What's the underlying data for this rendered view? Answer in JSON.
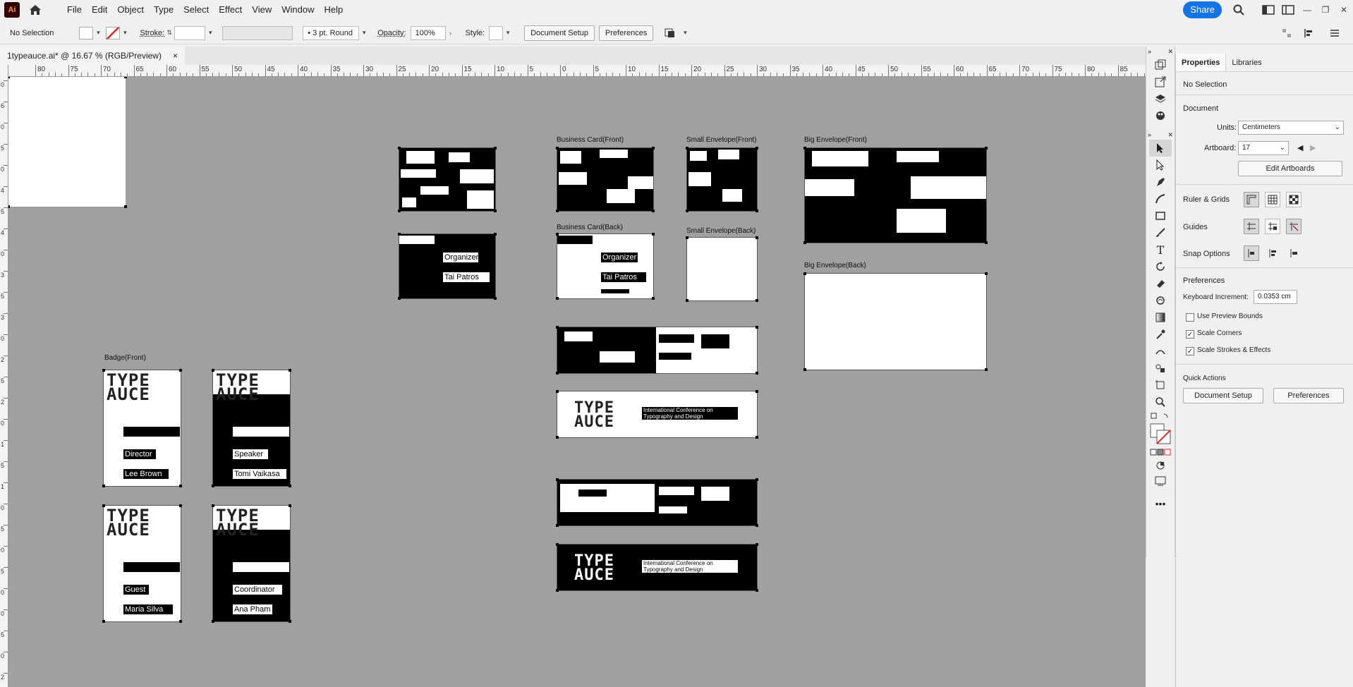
{
  "app": {
    "logo": "Ai"
  },
  "menu": [
    "File",
    "Edit",
    "Object",
    "Type",
    "Select",
    "Effect",
    "View",
    "Window",
    "Help"
  ],
  "topbar": {
    "share": "Share"
  },
  "control": {
    "selection": "No Selection",
    "stroke_label": "Stroke:",
    "brush": "3 pt. Round",
    "opacity_label": "Opacity:",
    "opacity": "100%",
    "style_label": "Style:",
    "doc_setup": "Document Setup",
    "preferences": "Preferences"
  },
  "doc_tab": {
    "title": "1typeauce.ai* @ 16.67 % (RGB/Preview)",
    "close": "×"
  },
  "ruler": {
    "labels": [
      "80",
      "75",
      "70",
      "65",
      "60",
      "55",
      "50",
      "45",
      "40",
      "35",
      "30",
      "25",
      "20",
      "15",
      "10",
      "5",
      "0",
      "5",
      "10",
      "15",
      "20",
      "25",
      "30",
      "35",
      "40",
      "45",
      "50",
      "55",
      "60",
      "65",
      "70",
      "75",
      "80",
      "85"
    ]
  },
  "ruler_v": {
    "labels": [
      "0",
      "6",
      "0",
      "5",
      "0",
      "4",
      "5",
      "4",
      "0",
      "3",
      "5",
      "3",
      "0",
      "2",
      "5",
      "2",
      "0",
      "1",
      "5",
      "1",
      "0",
      "5",
      "0",
      "5",
      "0",
      "0",
      "5",
      "0",
      "2"
    ]
  },
  "artboards": {
    "bc_front": "Business Card(Front)",
    "bc_back": "Business Card(Back)",
    "se_front": "Small Envelope(Front)",
    "se_back": "Small Envelope(Back)",
    "be_front": "Big Envelope(Front)",
    "be_back": "Big Envelope(Back)",
    "badge_front": "Badge(Front)"
  },
  "card_texts": {
    "organizer": "Organizer",
    "name1": "Tai Patros",
    "conference": "International Conference on Typography and Design",
    "conf_line1": "International Conference on",
    "conf_line2": "Typography and Design"
  },
  "badges": [
    {
      "role": "Director",
      "name": "Lee Brown"
    },
    {
      "role": "Speaker",
      "name": "Tomi Vaikasa"
    },
    {
      "role": "Guest",
      "name": "Maria Silva"
    },
    {
      "role": "Coordinator",
      "name": "Ana Pham"
    }
  ],
  "logo_text": {
    "line1": "TYPE",
    "line2": "AUCE"
  },
  "panel": {
    "tabs": [
      "Properties",
      "Libraries"
    ],
    "selection": "No Selection",
    "document": "Document",
    "units_label": "Units:",
    "units": "Centimeters",
    "artboard_label": "Artboard:",
    "artboard": "17",
    "edit_artboards": "Edit Artboards",
    "ruler_grids": "Ruler & Grids",
    "guides": "Guides",
    "snap": "Snap Options",
    "preferences": "Preferences",
    "kb_label": "Keyboard Increment:",
    "kb_value": "0.0353 cm",
    "use_preview": "Use Preview Bounds",
    "scale_corners": "Scale Corners",
    "scale_strokes": "Scale Strokes & Effects",
    "quick_actions": "Quick Actions",
    "qa_doc_setup": "Document Setup",
    "qa_prefs": "Preferences"
  }
}
